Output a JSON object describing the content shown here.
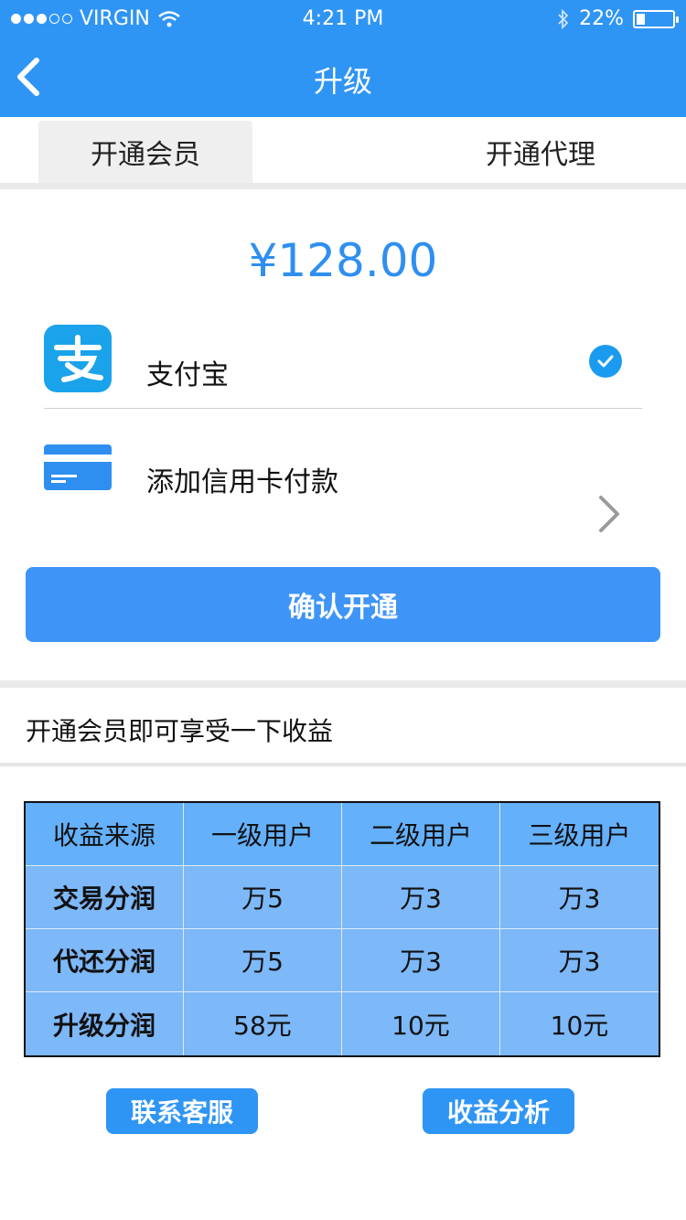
{
  "status_bar": {
    "carrier": "VIRGIN",
    "time": "4:21 PM",
    "battery": "22%"
  },
  "nav": {
    "title": "升级"
  },
  "tabs": [
    {
      "label": "开通会员",
      "active": true
    },
    {
      "label": "开通代理",
      "active": false
    }
  ],
  "price": "¥128.00",
  "payment": {
    "alipay_label": "支付宝",
    "card_label": "添加信用卡付款"
  },
  "confirm_label": "确认开通",
  "benefit_title": "开通会员即可享受一下收益",
  "table": {
    "headers": [
      "收益来源",
      "一级用户",
      "二级用户",
      "三级用户"
    ],
    "rows": [
      [
        "交易分润",
        "万5",
        "万3",
        "万3"
      ],
      [
        "代还分润",
        "万5",
        "万3",
        "万3"
      ],
      [
        "升级分润",
        "58元",
        "10元",
        "10元"
      ]
    ]
  },
  "buttons": {
    "contact": "联系客服",
    "analysis": "收益分析"
  },
  "colors": {
    "primary": "#2f95f5",
    "price": "#2f8ff0",
    "table_bg": "#7db8f8",
    "check": "#1a9bf0"
  }
}
